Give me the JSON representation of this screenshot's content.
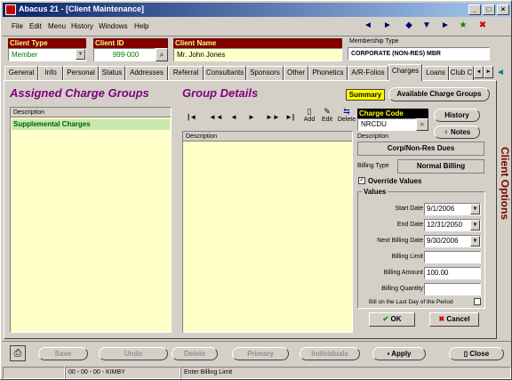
{
  "window": {
    "title": "Abacus 21 - [Client Maintenance]"
  },
  "menu": [
    "File",
    "Edit",
    "Menu",
    "History",
    "Windows",
    "Help"
  ],
  "header": {
    "client_type_label": "Client Type",
    "client_type_value": "Member",
    "client_id_label": "Client ID",
    "client_id_value": "999-000",
    "client_name_label": "Client Name",
    "client_name_value": "Mr. John  Jones",
    "membership_type_label": "Membership Type",
    "membership_type_value": "CORPORATE (NON-RES) MBR"
  },
  "tabs": [
    "General",
    "Info",
    "Personal",
    "Status",
    "Addresses",
    "Referral",
    "Consultants",
    "Sponsors",
    "Other",
    "Phonetics",
    "A/R-Folios",
    "Charges",
    "Loans",
    "Club C"
  ],
  "active_tab": "Charges",
  "side_label": "Client Options",
  "assigned": {
    "title": "Assigned Charge Groups",
    "col": "Description",
    "rows": [
      "Supplemental Charges"
    ]
  },
  "details": {
    "title": "Group Details",
    "col": "Description",
    "add": "Add",
    "edit": "Edit",
    "delete": "Delete"
  },
  "right": {
    "summary": "Summary",
    "available": "Available Charge Groups",
    "charge_code_label": "Charge Code",
    "charge_code_value": "NRCDU",
    "history": "History",
    "notes": "Notes",
    "description_label": "Description",
    "description_value": "Corp/Non-Res Dues",
    "billing_type_label": "Billing Type",
    "billing_type_value": "Normal Billing",
    "override_label": "Override Values",
    "values_label": "Values",
    "start_label": "Start Date",
    "start_value": "9/1/2006",
    "end_label": "End Date",
    "end_value": "12/31/2050",
    "next_label": "Next Billing Date",
    "next_value": "9/30/2006",
    "limit_label": "Billing Limit",
    "limit_value": "",
    "amount_label": "Billing Amount",
    "amount_value": "100.00",
    "qty_label": "Billing Quantity",
    "qty_value": "",
    "last_day_label": "Bill on the Last Day of the Period",
    "ok": "OK",
    "cancel": "Cancel"
  },
  "bottom": {
    "save": "Save",
    "undo": "Undo",
    "delete": "Delete",
    "primary": "Primary",
    "individuals": "Individuals",
    "apply": "Apply",
    "close": "Close"
  },
  "status": {
    "time": "00 - 00 - 00 - KIMBY",
    "message": "Enter Billing Limit"
  }
}
